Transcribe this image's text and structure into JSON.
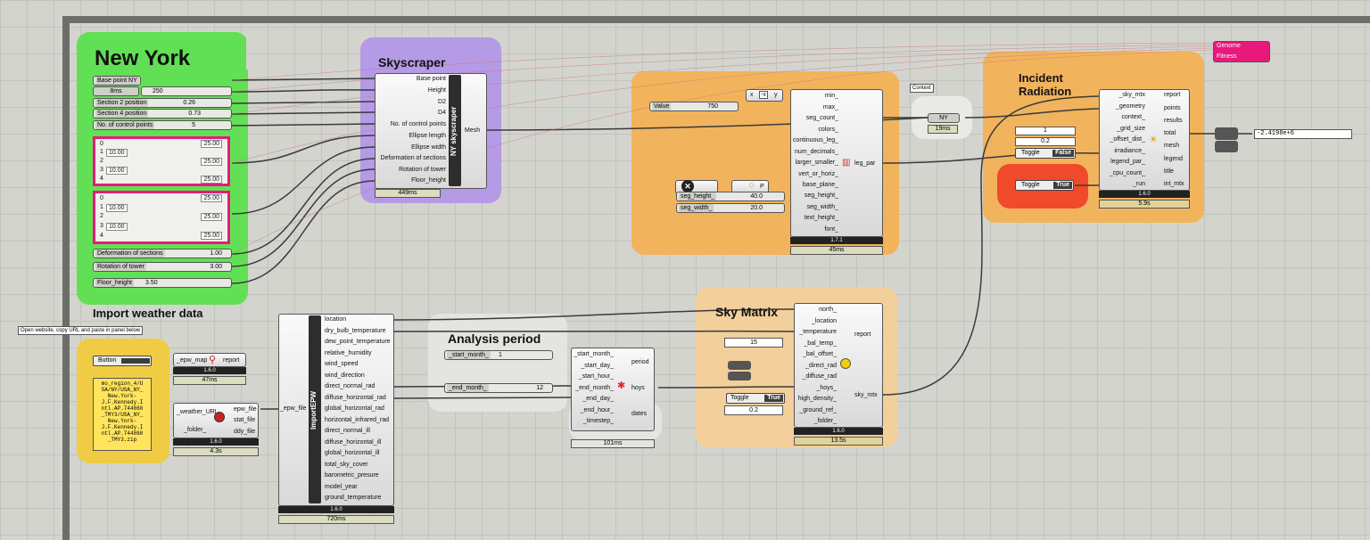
{
  "groups": {
    "new_york": "New York",
    "skyscraper": "Skyscraper",
    "incident": "Incident Radiation",
    "sky_matrix": "Sky Matrix",
    "analysis": "Analysis period",
    "import": "Import weather data"
  },
  "new_york": {
    "base_point": "Base point NY",
    "ms": "8ms",
    "num_slider": "250",
    "s2": {
      "label": "Section 2 position",
      "value": "0.26"
    },
    "s4": {
      "label": "Section 4 position",
      "value": "0.73"
    },
    "cp": {
      "label": "No. of control points",
      "value": "5"
    },
    "graph1": {
      "r0": "0",
      "r1": "1",
      "r2": "2",
      "r3": "3",
      "r4": "4",
      "v1": "10.00",
      "v3": "10.00",
      "a": "25.00",
      "b": "25.00",
      "c": "25.00",
      "d": "25.00"
    },
    "graph2": {
      "r0": "0",
      "r1": "1",
      "r2": "2",
      "r3": "3",
      "r4": "4",
      "v1": "10.00",
      "v3": "10.00",
      "a": "25.00",
      "b": "25.00",
      "c": "25.00",
      "d": "25.00"
    },
    "deform": {
      "label": "Deformation of sections",
      "value": "1.00"
    },
    "rot": {
      "label": "Rotation of tower",
      "value": "3.00"
    },
    "floor": {
      "label": "Floor_height",
      "value": "3.50"
    }
  },
  "skyscraper": {
    "inputs": [
      "Base point",
      "Height",
      "D2",
      "D4",
      "No. of control points",
      "Ellipse length",
      "Ellipse width",
      "Deformation of sections",
      "Rotation of tower",
      "Floor_height"
    ],
    "name": "NY skyscraper",
    "output": "Mesh",
    "time": "449ms"
  },
  "legend": {
    "value_label": "Value",
    "value": "750",
    "expr": {
      "x": "x",
      "f": "-x",
      "y": "y"
    },
    "inputs": [
      "min_",
      "max_",
      "seg_count_",
      "colors_",
      "continuous_leg_",
      "num_decimals_",
      "larger_smaller_",
      "vert_or_horiz_",
      "base_plane_",
      "seg_height_",
      "seg_width_",
      "text_height_",
      "font_"
    ],
    "output": "leg_par",
    "version": "1.7.1",
    "time": "45ms",
    "seg_height": {
      "label": "seg_height_",
      "value": "40.0"
    },
    "seg_width": {
      "label": "seg_width_",
      "value": "20.0"
    },
    "p": "P"
  },
  "context": {
    "tip": "Context",
    "ny": "NY",
    "time": "19ms"
  },
  "incident": {
    "inputs": [
      "_sky_mtx",
      "_geometry",
      "context_",
      "_grid_size",
      "_offset_dist_",
      "irradiance_",
      "legend_par_",
      "_cpu_count_",
      "_run"
    ],
    "outputs": [
      "report",
      "points",
      "results",
      "total",
      "mesh",
      "legend",
      "title",
      "int_mtx"
    ],
    "grid": "1",
    "offset": "0.2",
    "toggle1": {
      "label": "Toggle",
      "value": "False"
    },
    "toggle2": {
      "label": "Toggle",
      "value": "True"
    },
    "version": "1.6.0",
    "time": "5.9s",
    "total": "-2.4198e+6"
  },
  "genome": {
    "a": "Genome",
    "b": "Fitness"
  },
  "sky": {
    "inputs": [
      "north_",
      "_location",
      "_temperature",
      "_bal_temp_",
      "_bal_offset_",
      "_direct_rad",
      "_diffuse_rad",
      "_hoys_",
      "high_density_",
      "_ground_ref_",
      "_folder_"
    ],
    "outputs": [
      "report",
      "sky_mtx"
    ],
    "bal_temp": "15",
    "ground": "0.2",
    "toggle": {
      "label": "Toggle",
      "value": "True"
    },
    "version": "1.6.0",
    "time": "13.5s"
  },
  "analysis": {
    "start": {
      "label": "_start_month_",
      "value": "1"
    },
    "end": {
      "label": "_end_month_",
      "value": "12"
    },
    "inputs": [
      "_start_month_",
      "_start_day_",
      "_start_hour_",
      "_end_month_",
      "_end_day_",
      "_end_hour_",
      "_timestep_"
    ],
    "outputs": [
      "period",
      "hoys",
      "dates"
    ],
    "time": "101ms"
  },
  "import": {
    "tip": "Open website, copy URL and paste in panel below",
    "button": "Button",
    "epw_map": "_epw_map",
    "report": "report",
    "v1": "1.6.0",
    "t1": "47ms",
    "url_text": "mo_region_4/USA/NY/USA_NY_New.York-J.F.Kennedy.Intl.AP.744860_TMY3/USA_NY_New.York-J.F.Kennedy.Intl.AP.744860_TMY3.zip",
    "url_lines": [
      "mo_region_4/U",
      "SA/NY/USA_NY_",
      "New.York-",
      "J.F.Kennedy.I",
      "ntl.AP.744860",
      "_TMY3/USA_NY_",
      "New.York-",
      "J.F.Kennedy.I",
      "ntl.AP.744860",
      "_TMY3.zip"
    ],
    "weather_url": "_weather_URL",
    "folder": "_folder_",
    "dl_outs": [
      "epw_file",
      "stat_file",
      "ddy_file"
    ],
    "v2": "1.6.0",
    "t2": "4.3s",
    "epw_in": "_epw_file",
    "name": "ImportEPW",
    "outs": [
      "location",
      "dry_bulb_temperature",
      "dew_point_temperature",
      "relative_humidity",
      "wind_speed",
      "wind_direction",
      "direct_normal_rad",
      "diffuse_horizontal_rad",
      "global_horizontal_rad",
      "horizontal_infrared_rad",
      "direct_normal_ill",
      "diffuse_horizontal_ill",
      "global_horizontal_ill",
      "total_sky_cover",
      "barometric_presure",
      "model_year",
      "ground_temperature"
    ],
    "v3": "1.6.0",
    "t3": "720ms"
  },
  "colors": {
    "green": "#62e055",
    "purple": "#b59ae6",
    "orange": "#f2b35d",
    "yellow": "#f0cc45",
    "pink": "#e8197c",
    "red": "#f04a2a"
  }
}
